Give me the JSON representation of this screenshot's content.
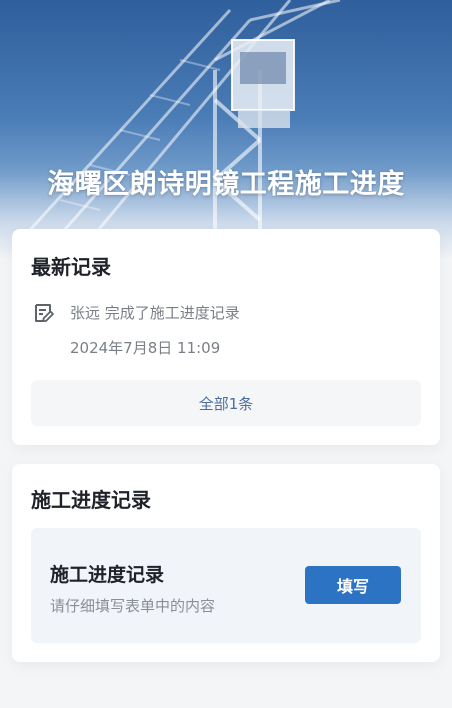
{
  "header": {
    "title": "海曙区朗诗明镜工程施工进度"
  },
  "latest": {
    "title": "最新记录",
    "record": {
      "icon": "edit-note-icon",
      "user_action": "张远 完成了施工进度记录",
      "timestamp": "2024年7月8日 11:09"
    },
    "all_label": "全部1条"
  },
  "progress": {
    "title": "施工进度记录",
    "form_title": "施工进度记录",
    "form_subtitle": "请仔细填写表单中的内容",
    "fill_label": "填写"
  },
  "colors": {
    "accent": "#2d73c4",
    "hero_sky": "#2f5f9c"
  }
}
